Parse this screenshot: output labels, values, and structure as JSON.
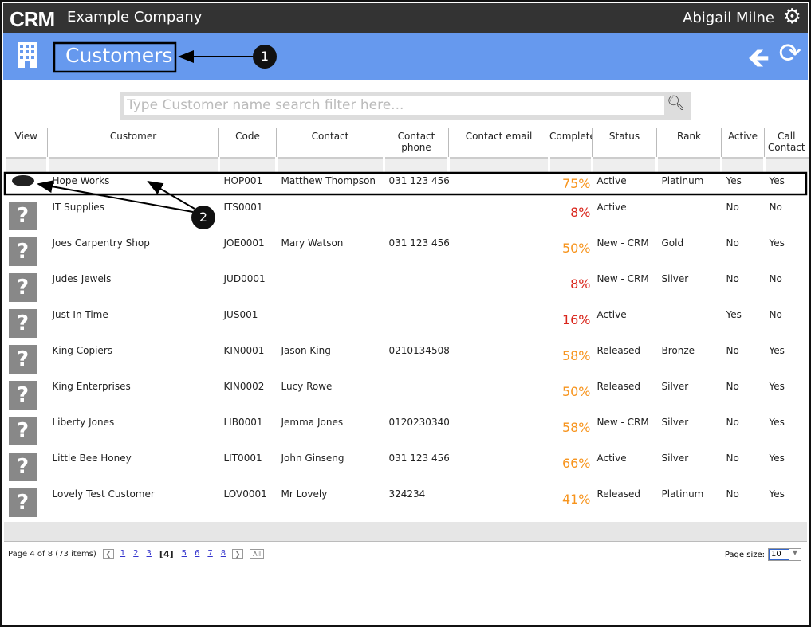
{
  "header": {
    "logo": "CRM",
    "company": "Example Company",
    "user": "Abigail Milne",
    "settings_icon": "gear-icon"
  },
  "page": {
    "title": "Customers",
    "back_icon": "arrow-left-icon",
    "refresh_icon": "refresh-icon"
  },
  "search": {
    "placeholder": "Type Customer name search filter here...",
    "value": ""
  },
  "columns": [
    "View",
    "Customer",
    "Code",
    "Contact",
    "Contact phone",
    "Contact email",
    "Complete",
    "Status",
    "Rank",
    "Active",
    "Call Contact"
  ],
  "rows": [
    {
      "customer": "Hope Works",
      "code": "HOP001",
      "contact": "Matthew Thompson",
      "phone": "031 123 456",
      "email": "",
      "complete": "75%",
      "color": "#f7941d",
      "status": "Active",
      "rank": "Platinum",
      "active": "Yes",
      "call": "Yes",
      "has_logo": true
    },
    {
      "customer": "IT Supplies",
      "code": "ITS0001",
      "contact": "",
      "phone": "",
      "email": "",
      "complete": "8%",
      "color": "#d9261c",
      "status": "Active",
      "rank": "",
      "active": "No",
      "call": "No"
    },
    {
      "customer": "Joes Carpentry Shop",
      "code": "JOE0001",
      "contact": "Mary Watson",
      "phone": "031 123 456",
      "email": "",
      "complete": "50%",
      "color": "#f7941d",
      "status": "New - CRM",
      "rank": "Gold",
      "active": "No",
      "call": "Yes"
    },
    {
      "customer": "Judes Jewels",
      "code": "JUD0001",
      "contact": "",
      "phone": "",
      "email": "",
      "complete": "8%",
      "color": "#d9261c",
      "status": "New - CRM",
      "rank": "Silver",
      "active": "No",
      "call": "No"
    },
    {
      "customer": "Just In Time",
      "code": "JUS001",
      "contact": "",
      "phone": "",
      "email": "",
      "complete": "16%",
      "color": "#d9261c",
      "status": "Active",
      "rank": "",
      "active": "Yes",
      "call": "No"
    },
    {
      "customer": "King Copiers",
      "code": "KIN0001",
      "contact": "Jason King",
      "phone": "0210134508",
      "email": "",
      "complete": "58%",
      "color": "#f7941d",
      "status": "Released",
      "rank": "Bronze",
      "active": "No",
      "call": "Yes"
    },
    {
      "customer": "King Enterprises",
      "code": "KIN0002",
      "contact": "Lucy Rowe",
      "phone": "",
      "email": "",
      "complete": "50%",
      "color": "#f7941d",
      "status": "Released",
      "rank": "Silver",
      "active": "No",
      "call": "Yes"
    },
    {
      "customer": "Liberty Jones",
      "code": "LIB0001",
      "contact": "Jemma Jones",
      "phone": "0120230340",
      "email": "",
      "complete": "58%",
      "color": "#f7941d",
      "status": "New - CRM",
      "rank": "Silver",
      "active": "No",
      "call": "Yes"
    },
    {
      "customer": "Little Bee Honey",
      "code": "LIT0001",
      "contact": "John Ginseng",
      "phone": "031 123 456",
      "email": "",
      "complete": "66%",
      "color": "#f7941d",
      "status": "Active",
      "rank": "Silver",
      "active": "No",
      "call": "Yes"
    },
    {
      "customer": "Lovely Test Customer",
      "code": "LOV0001",
      "contact": "Mr Lovely",
      "phone": "324234",
      "email": "",
      "complete": "41%",
      "color": "#f7941d",
      "status": "Released",
      "rank": "Platinum",
      "active": "No",
      "call": "Yes"
    }
  ],
  "pager": {
    "summary": "Page 4 of 8 (73 items)",
    "pages": [
      "1",
      "2",
      "3",
      "[4]",
      "5",
      "6",
      "7",
      "8"
    ],
    "all": "All",
    "page_size_label": "Page size:",
    "page_size": "10"
  },
  "annotations": [
    "1",
    "2"
  ]
}
